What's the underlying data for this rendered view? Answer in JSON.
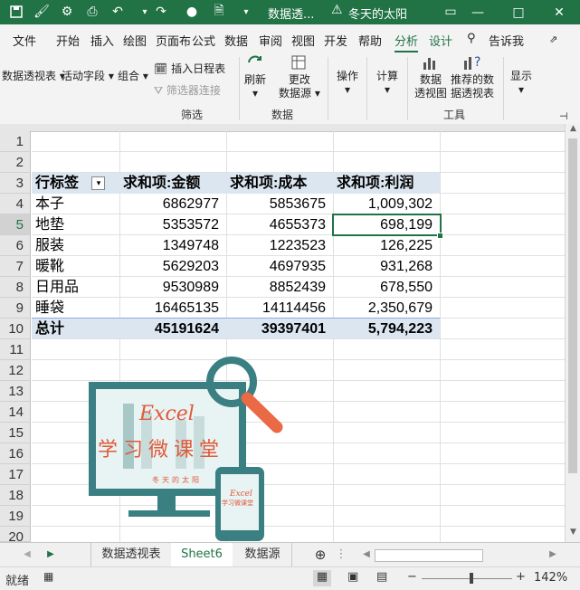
{
  "titlebar": {
    "doc_title": "数据透...",
    "user_name": "冬天的太阳",
    "minimize": "—",
    "restore": "□",
    "close": "✕"
  },
  "tabs": [
    "文件",
    "开始",
    "插入",
    "绘图",
    "页面布",
    "公式",
    "数据",
    "审阅",
    "视图",
    "开发",
    "帮助",
    "分析",
    "设计",
    "告诉我"
  ],
  "ribbon": {
    "pivot_table": "数据透视表",
    "active_field": "活动字段",
    "group": "组合",
    "insert_timeline": "插入日程表",
    "filter_connection": "筛选器连接",
    "filter_group": "筛选",
    "refresh": "刷新",
    "change_source_1": "更改",
    "change_source_2": "数据源",
    "data_group": "数据",
    "actions": "操作",
    "calculations": "计算",
    "pivot_chart_1": "数据",
    "pivot_chart_2": "透视图",
    "recommended_1": "推荐的数",
    "recommended_2": "据透视表",
    "tools_group": "工具",
    "show": "显示"
  },
  "rows": [
    "1",
    "2",
    "3",
    "4",
    "5",
    "6",
    "7",
    "8",
    "9",
    "10",
    "11",
    "12",
    "13",
    "14",
    "15",
    "16",
    "17",
    "18",
    "19",
    "20"
  ],
  "pivot": {
    "headers": [
      "行标签",
      "求和项:金额",
      "求和项:成本",
      "求和项:利润"
    ],
    "data": [
      {
        "label": "本子",
        "amount": "6862977",
        "cost": "5853675",
        "profit": "1,009,302"
      },
      {
        "label": "地垫",
        "amount": "5353572",
        "cost": "4655373",
        "profit": "698,199"
      },
      {
        "label": "服装",
        "amount": "1349748",
        "cost": "1223523",
        "profit": "126,225"
      },
      {
        "label": "暖靴",
        "amount": "5629203",
        "cost": "4697935",
        "profit": "931,268"
      },
      {
        "label": "日用品",
        "amount": "9530989",
        "cost": "8852439",
        "profit": "678,550"
      },
      {
        "label": "睡袋",
        "amount": "16465135",
        "cost": "14114456",
        "profit": "2,350,679"
      }
    ],
    "total": {
      "label": "总计",
      "amount": "45191624",
      "cost": "39397401",
      "profit": "5,794,223"
    }
  },
  "logo": {
    "word": "Excel",
    "tagline": "学习微课堂",
    "author": "冬天的太阳",
    "phone_word": "Excel",
    "phone_tagline": "学习微课堂"
  },
  "sheet_tabs": [
    "数据透视表",
    "Sheet6",
    "数据源"
  ],
  "status": {
    "mode": "就绪",
    "zoom": "142%",
    "minus": "−",
    "plus": "+"
  }
}
